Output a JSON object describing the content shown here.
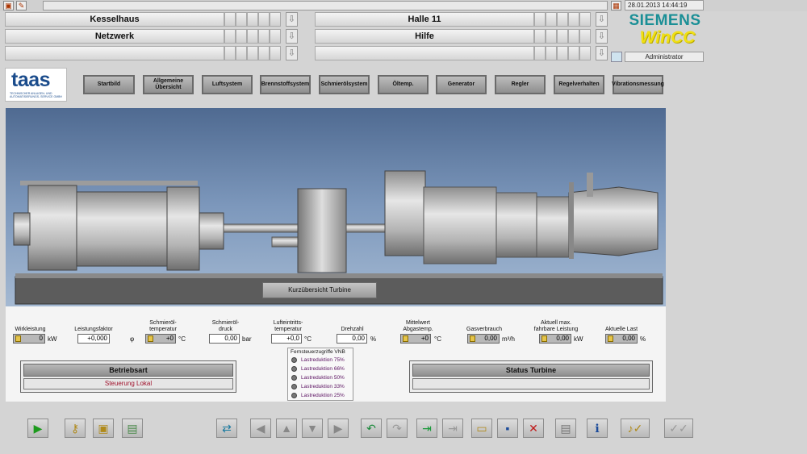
{
  "header": {
    "datetime": "28.01.2013 14:44:19",
    "brand": "SIEMENS",
    "product": "WinCC",
    "user": "Administrator"
  },
  "nav": {
    "left": [
      "Kesselhaus",
      "Netzwerk",
      ""
    ],
    "right": [
      "Halle 11",
      "Hilfe",
      ""
    ]
  },
  "logo": {
    "name": "taas",
    "tagline": "TECHNISCHER ANLAGEN- UND AUTOMATISIERUNGS- SERVICE GMBH"
  },
  "menu": [
    "Startbild",
    "Allgemeine Übersicht",
    "Luftsystem",
    "Brennstoffsystem",
    "Schmierölsystem",
    "Öltemp.",
    "Generator",
    "Regler",
    "Regelverhalten",
    "Vibrationsmessung"
  ],
  "scene": {
    "button": "Kurzübersicht Turbine"
  },
  "measurements": {
    "wirkleistung": {
      "label": "Wirkleistung",
      "value": "0",
      "unit": "kW"
    },
    "leistungsfaktor": {
      "label": "Leistungsfaktor",
      "value": "+0,000",
      "unit": "φ"
    },
    "schmieroel_temp": {
      "label": "Schmieröl-\ntemperatur",
      "value": "+0",
      "unit": "°C"
    },
    "schmieroel_druck": {
      "label": "Schmieröl-\ndruck",
      "value": "0,00",
      "unit": "bar"
    },
    "lufteintritt_temp": {
      "label": "Lufteintritts-\ntemperatur",
      "value": "+0,0",
      "unit": "°C"
    },
    "drehzahl": {
      "label": "Drehzahl",
      "value": "0,00",
      "unit": "%"
    },
    "abgastemp": {
      "label": "Mittelwert\nAbgastemp.",
      "value": "+0",
      "unit": "°C"
    },
    "gasverbrauch": {
      "label": "Gasverbrauch",
      "value": "0,00",
      "unit": "m³/h"
    },
    "max_leistung": {
      "label": "Aktuell max.\nfahrbare Leistung",
      "value": "0,00",
      "unit": "kW"
    },
    "aktuelle_last": {
      "label": "Aktuelle Last",
      "value": "0,00",
      "unit": "%"
    }
  },
  "betriebsart": {
    "title": "Betriebsart",
    "value": "Steuerung Lokal"
  },
  "status": {
    "title": "Status Turbine",
    "value": ""
  },
  "fernsteuer": {
    "title": "Fernsteuerzugriffe VNB",
    "items": [
      "Lastreduktion 75%",
      "Lastreduktion 66%",
      "Lastreduktion 50%",
      "Lastreduktion 33%",
      "Lastreduktion 25%"
    ]
  },
  "toolbar_icons": [
    "play-icon",
    "key-icon",
    "window-icon",
    "report-icon",
    "transfer-icon",
    "arrow-left-icon",
    "arrow-up-icon",
    "arrow-down-icon",
    "arrow-right-icon",
    "undo-icon",
    "redo-icon",
    "import-icon",
    "export-icon",
    "open-icon",
    "save-icon",
    "delete-icon",
    "print-icon",
    "info-icon",
    "sound-ack-icon",
    "acknowledge-icon"
  ]
}
